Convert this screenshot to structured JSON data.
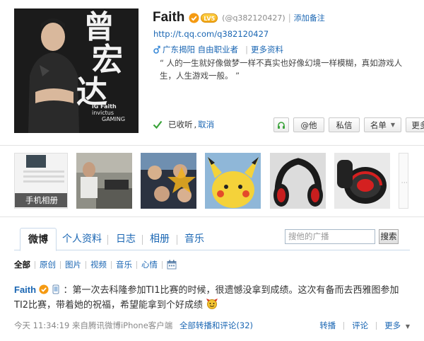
{
  "profile": {
    "name": "Faith",
    "level": "LV5",
    "handle": "(@q382120427)",
    "add_note": "添加备注",
    "homepage": "http://t.qq.com/q382120427",
    "location_job": "广东揭阳 自由职业者",
    "more_info": "更多资料",
    "signature": "“ 人的一生就好像做梦一样不真实也好像幻境一样模糊，真如游戏人生，人生游戏一般。 ”",
    "follow_status": "已收听",
    "cancel_follow": "取消",
    "avatar_text": {
      "calligraphy_1": "曾",
      "calligraphy_2": "宏",
      "calligraphy_3": "达",
      "team_line1": "iG Faith",
      "team_line2": "invictus",
      "team_line3": "GAMING"
    }
  },
  "actions": {
    "at_label": "@他",
    "message_label": "私信",
    "list_label": "名单",
    "more_label": "更多"
  },
  "album": {
    "label": "手机相册"
  },
  "tabs": {
    "weibo": "微博",
    "profile": "个人资料",
    "log": "日志",
    "album": "相册",
    "music": "音乐"
  },
  "search": {
    "placeholder": "搜他的广播",
    "button": "搜索"
  },
  "filters": {
    "all": "全部",
    "original": "原创",
    "photos": "图片",
    "videos": "视频",
    "music": "音乐",
    "mood": "心情"
  },
  "post": {
    "author": "Faith",
    "text": "：第一次去科隆参加TI1比赛的时候，很遗憾没拿到成绩。这次有备而去西雅图参加TI2比赛，带着她的祝福，希望能拿到个好成绩",
    "time": "今天 11:34:19 来自腾讯微博iPhone客户端",
    "all_replies_label": "全部转播和评论",
    "all_replies_count": "(32)",
    "repost": "转播",
    "comment": "评论",
    "more": "更多"
  },
  "colors": {
    "link": "#1a66b3",
    "verify_orange": "#f59a12",
    "check_green": "#3aa33a"
  },
  "icons": [
    "verify-icon",
    "gender-male-icon",
    "check-icon",
    "headphone-icon",
    "calendar-icon",
    "mobile-icon",
    "emoji-icon"
  ]
}
